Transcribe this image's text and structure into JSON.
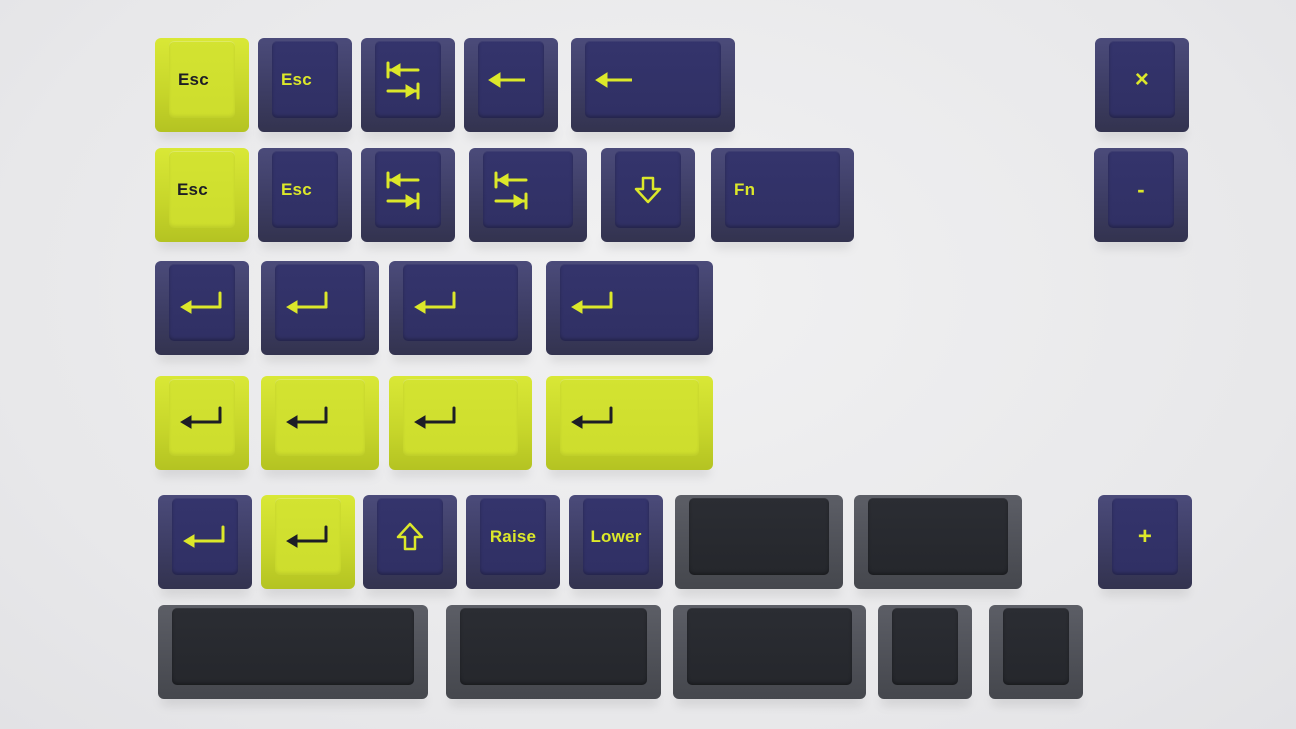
{
  "photo": {
    "subject": "keycaps",
    "colors": {
      "purple": "#34346c",
      "yellow": "#d3e331",
      "dark": "#2a2c31",
      "background": "#ececee"
    }
  },
  "keys": {
    "r1": {
      "k1": {
        "legend": "Esc",
        "color": "yellow"
      },
      "k2": {
        "legend": "Esc",
        "color": "purple"
      },
      "k3": {
        "icon": "tab-arrows-icon",
        "color": "purple"
      },
      "k4": {
        "icon": "backspace-arrow-icon",
        "color": "purple"
      },
      "k5": {
        "icon": "backspace-arrow-icon",
        "color": "purple"
      },
      "k6": {
        "legend": "×",
        "color": "purple"
      }
    },
    "r2": {
      "k1": {
        "legend": "Esc",
        "color": "yellow"
      },
      "k2": {
        "legend": "Esc",
        "color": "purple"
      },
      "k3": {
        "icon": "tab-arrows-icon",
        "color": "purple"
      },
      "k4": {
        "icon": "tab-arrows-icon",
        "color": "purple"
      },
      "k5": {
        "icon": "outline-down-arrow-icon",
        "color": "purple"
      },
      "k6": {
        "legend": "Fn",
        "color": "purple"
      },
      "k7": {
        "legend": "-",
        "color": "purple"
      }
    },
    "r3": {
      "icon": "enter-arrow-icon",
      "color": "purple"
    },
    "r4": {
      "icon": "enter-arrow-icon",
      "color": "yellow"
    },
    "r5": {
      "k1": {
        "icon": "enter-arrow-icon",
        "color": "purple"
      },
      "k2": {
        "icon": "enter-arrow-icon",
        "color": "yellow"
      },
      "k3": {
        "icon": "outline-up-arrow-icon",
        "color": "purple"
      },
      "k4": {
        "legend": "Raise",
        "color": "purple"
      },
      "k5": {
        "legend": "Lower",
        "color": "purple"
      },
      "k6": {
        "legend": "",
        "color": "dark"
      },
      "k7": {
        "legend": "",
        "color": "dark"
      },
      "k8": {
        "legend": "+",
        "color": "purple"
      }
    },
    "r6": {
      "legend": "",
      "color": "dark"
    }
  }
}
